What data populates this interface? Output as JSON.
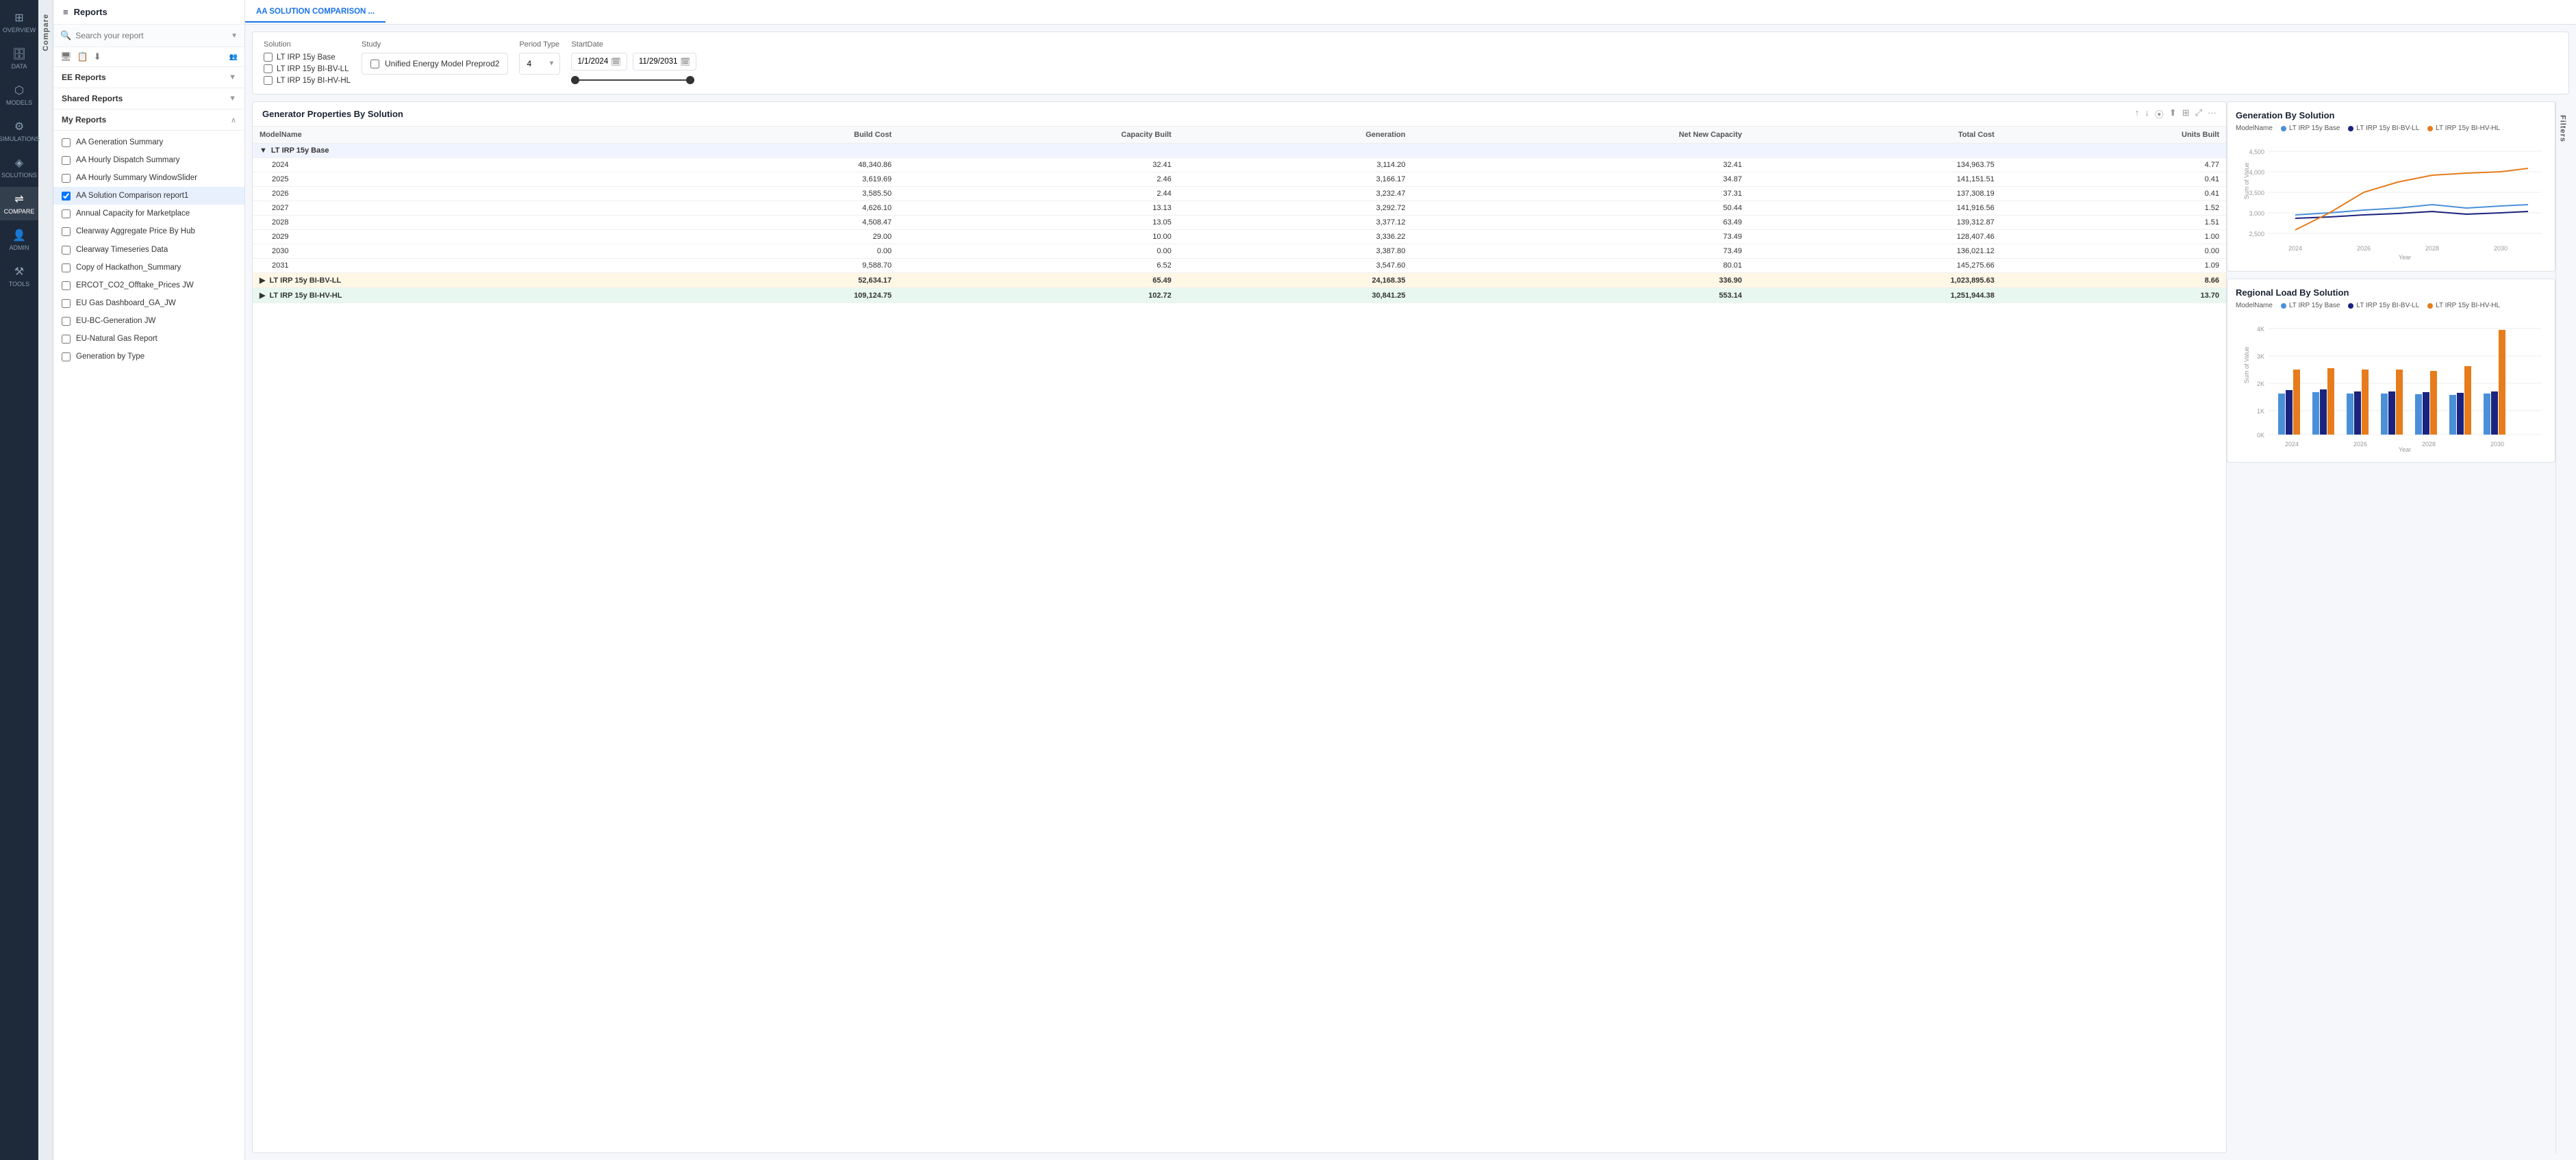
{
  "nav": {
    "items": [
      {
        "id": "overview",
        "label": "OVERVIEW",
        "icon": "⊞",
        "active": false
      },
      {
        "id": "data",
        "label": "DATA",
        "icon": "🗄",
        "active": false
      },
      {
        "id": "models",
        "label": "MODELS",
        "icon": "⬡",
        "active": false
      },
      {
        "id": "simulations",
        "label": "SIMULATIONS",
        "icon": "⚙",
        "active": false
      },
      {
        "id": "solutions",
        "label": "SOLUTIONS",
        "icon": "◈",
        "active": false
      },
      {
        "id": "compare",
        "label": "COMPARE",
        "icon": "⇌",
        "active": true
      },
      {
        "id": "admin",
        "label": "ADMIN",
        "icon": "👤",
        "active": false
      },
      {
        "id": "tools",
        "label": "TOOLS",
        "icon": "⚒",
        "active": false
      }
    ]
  },
  "reports_panel": {
    "title": "Reports",
    "search_placeholder": "Search your report",
    "toolbar": {
      "icons": [
        "🖥",
        "📋",
        "⬇"
      ]
    },
    "sections": {
      "ee_reports": {
        "label": "EE Reports",
        "expanded": false
      },
      "shared_reports": {
        "label": "Shared Reports",
        "expanded": false
      },
      "my_reports": {
        "label": "My Reports",
        "expanded": true
      }
    },
    "reports": [
      {
        "id": "aa-gen-summary",
        "label": "AA Generation Summary",
        "checked": false,
        "selected": false
      },
      {
        "id": "aa-hourly-dispatch",
        "label": "AA Hourly Dispatch Summary",
        "checked": false,
        "selected": false
      },
      {
        "id": "aa-hourly-summary",
        "label": "AA Hourly Summary WindowSlider",
        "checked": false,
        "selected": false
      },
      {
        "id": "aa-solution-comparison",
        "label": "AA Solution Comparison report1",
        "checked": true,
        "selected": true
      },
      {
        "id": "annual-capacity",
        "label": "Annual Capacity for Marketplace",
        "checked": false,
        "selected": false
      },
      {
        "id": "clearway-aggregate",
        "label": "Clearway Aggregate Price By Hub",
        "checked": false,
        "selected": false
      },
      {
        "id": "clearway-timeseries",
        "label": "Clearway Timeseries Data",
        "checked": false,
        "selected": false
      },
      {
        "id": "copy-hackathon",
        "label": "Copy of Hackathon_Summary",
        "checked": false,
        "selected": false
      },
      {
        "id": "ercot-co2",
        "label": "ERCOT_CO2_Offtake_Prices JW",
        "checked": false,
        "selected": false
      },
      {
        "id": "eu-gas-dashboard",
        "label": "EU Gas Dashboard_GA_JW",
        "checked": false,
        "selected": false
      },
      {
        "id": "eu-bc-generation",
        "label": "EU-BC-Generation JW",
        "checked": false,
        "selected": false
      },
      {
        "id": "eu-natural-gas",
        "label": "EU-Natural Gas Report",
        "checked": false,
        "selected": false
      },
      {
        "id": "generation-by-type",
        "label": "Generation by Type",
        "checked": false,
        "selected": false
      }
    ]
  },
  "tab_bar": {
    "tabs": [
      {
        "id": "aa-solution-comparison",
        "label": "AA SOLUTION COMPARISON ...",
        "active": true
      }
    ]
  },
  "controls": {
    "solution_label": "Solution",
    "solutions": [
      {
        "id": "lt-irp-15y-base",
        "label": "LT IRP 15y Base",
        "checked": false
      },
      {
        "id": "lt-irp-15y-bi-bv-ll",
        "label": "LT IRP 15y BI-BV-LL",
        "checked": false
      },
      {
        "id": "lt-irp-15y-bi-hv-hl",
        "label": "LT IRP 15y BI-HV-HL",
        "checked": false
      }
    ],
    "study_label": "Study",
    "study_value": "Unified Energy Model Preprod2",
    "period_label": "Period Type",
    "period_value": "4",
    "startdate_label": "StartDate",
    "date_start": "1/1/2024",
    "date_end": "11/29/2031"
  },
  "table": {
    "title": "Generator Properties By Solution",
    "columns": [
      "ModelName",
      "Build Cost",
      "Capacity Built",
      "Generation",
      "Net New Capacity",
      "Total Cost",
      "Units Built"
    ],
    "groups": [
      {
        "name": "LT IRP 15y Base",
        "style": "group-row",
        "rows": [
          {
            "year": "2024",
            "build_cost": "48,340.86",
            "capacity_built": "32.41",
            "generation": "3,114.20",
            "net_new_capacity": "32.41",
            "total_cost": "134,963.75",
            "units_built": "4.77"
          },
          {
            "year": "2025",
            "build_cost": "3,619.69",
            "capacity_built": "2.46",
            "generation": "3,166.17",
            "net_new_capacity": "34.87",
            "total_cost": "141,151.51",
            "units_built": "0.41"
          },
          {
            "year": "2026",
            "build_cost": "3,585.50",
            "capacity_built": "2.44",
            "generation": "3,232.47",
            "net_new_capacity": "37.31",
            "total_cost": "137,308.19",
            "units_built": "0.41"
          },
          {
            "year": "2027",
            "build_cost": "4,626.10",
            "capacity_built": "13.13",
            "generation": "3,292.72",
            "net_new_capacity": "50.44",
            "total_cost": "141,916.56",
            "units_built": "1.52"
          },
          {
            "year": "2028",
            "build_cost": "4,508.47",
            "capacity_built": "13.05",
            "generation": "3,377.12",
            "net_new_capacity": "63.49",
            "total_cost": "139,312.87",
            "units_built": "1.51"
          },
          {
            "year": "2029",
            "build_cost": "29.00",
            "capacity_built": "10.00",
            "generation": "3,336.22",
            "net_new_capacity": "73.49",
            "total_cost": "128,407.46",
            "units_built": "1.00"
          },
          {
            "year": "2030",
            "build_cost": "0.00",
            "capacity_built": "0.00",
            "generation": "3,387.80",
            "net_new_capacity": "73.49",
            "total_cost": "136,021.12",
            "units_built": "0.00"
          },
          {
            "year": "2031",
            "build_cost": "9,588.70",
            "capacity_built": "6.52",
            "generation": "3,547.60",
            "net_new_capacity": "80.01",
            "total_cost": "145,275.66",
            "units_built": "1.09"
          }
        ]
      },
      {
        "name": "LT IRP 15y BI-BV-LL",
        "style": "group-row-alt",
        "build_cost": "52,634.17",
        "capacity_built": "65.49",
        "generation": "24,168.35",
        "net_new_capacity": "336.90",
        "total_cost": "1,023,895.63",
        "units_built": "8.66"
      },
      {
        "name": "LT IRP 15y BI-HV-HL",
        "style": "group-row-alt2",
        "build_cost": "109,124.75",
        "capacity_built": "102.72",
        "generation": "30,841.25",
        "net_new_capacity": "553.14",
        "total_cost": "1,251,944.38",
        "units_built": "13.70"
      }
    ]
  },
  "charts": {
    "line_chart": {
      "title": "Generation By Solution",
      "model_label": "ModelName",
      "series": [
        {
          "name": "LT IRP 15y Base",
          "color": "#4a90d9"
        },
        {
          "name": "LT IRP 15y BI-BV-LL",
          "color": "#1a237e"
        },
        {
          "name": "LT IRP 15y BI-HV-HL",
          "color": "#e67c1b"
        }
      ],
      "y_label": "Sum of Value",
      "x_label": "Year",
      "y_ticks": [
        "2,500",
        "3,000",
        "3,500",
        "4,000",
        "4,500"
      ],
      "x_ticks": [
        "2024",
        "2026",
        "2028",
        "2030"
      ]
    },
    "bar_chart": {
      "title": "Regional Load By Solution",
      "model_label": "ModelName",
      "series": [
        {
          "name": "LT IRP 15y Base",
          "color": "#4a90d9"
        },
        {
          "name": "LT IRP 15y BI-BV-LL",
          "color": "#1a237e"
        },
        {
          "name": "LT IRP 15y BI-HV-HL",
          "color": "#e67c1b"
        }
      ],
      "y_label": "Sum of Value",
      "x_label": "Year",
      "y_ticks": [
        "0K",
        "1K",
        "2K",
        "3K",
        "4K"
      ],
      "x_ticks": [
        "2024",
        "2026",
        "2028",
        "2030"
      ]
    }
  },
  "filters_label": "Filters"
}
